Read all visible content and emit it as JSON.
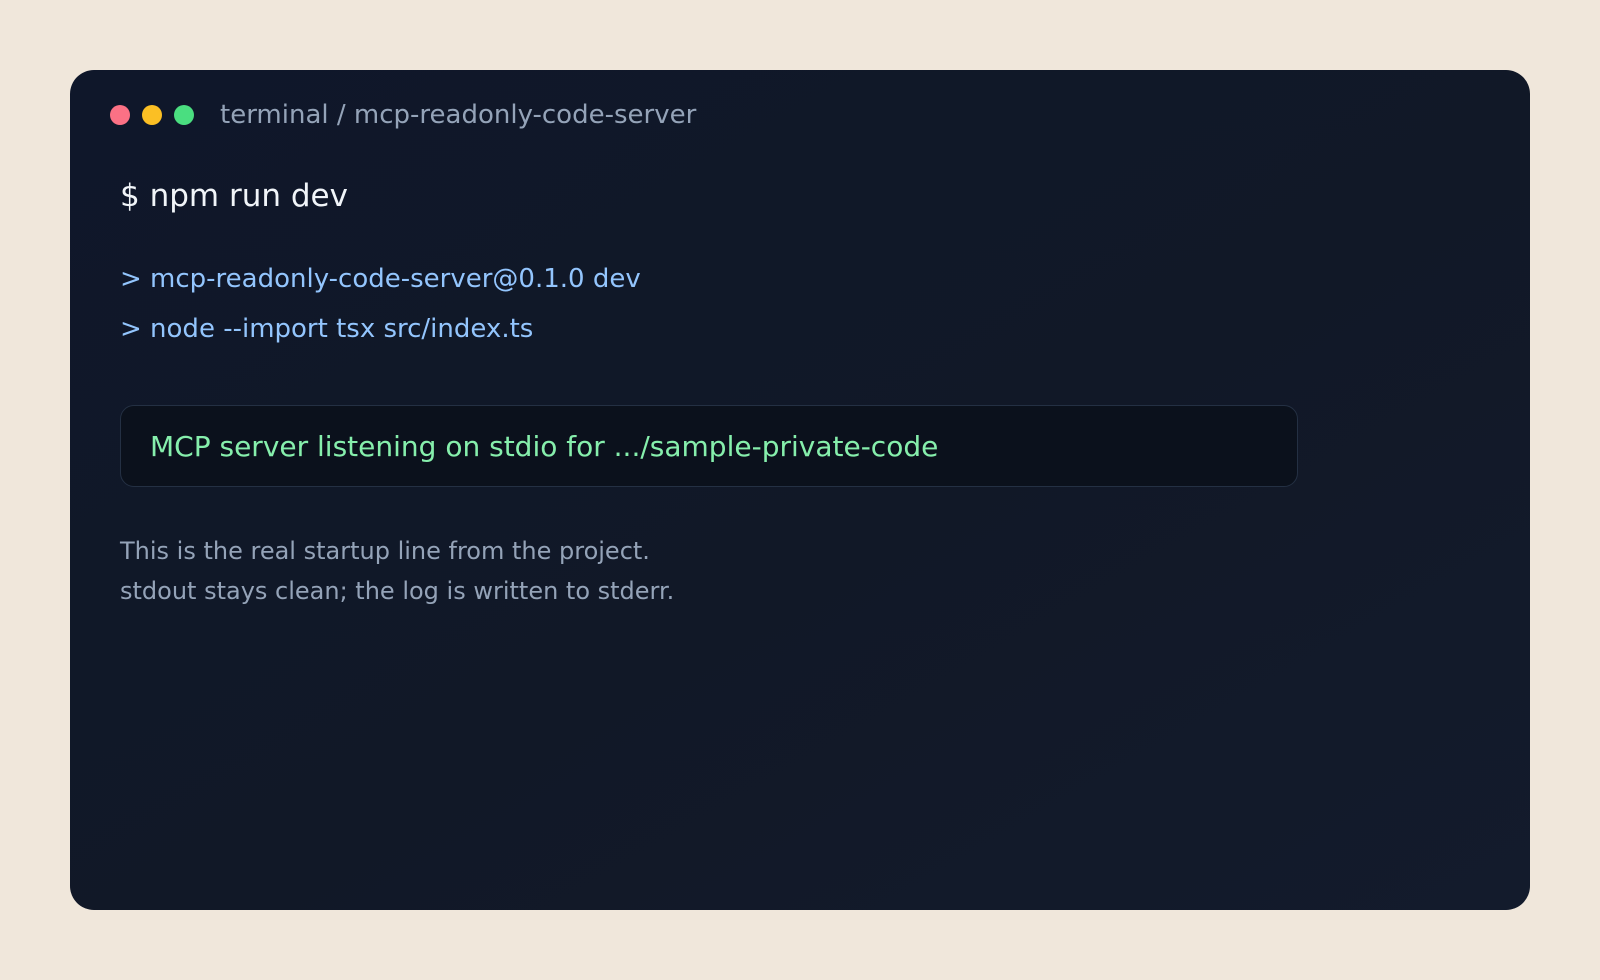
{
  "colors": {
    "background": "#f0e7db",
    "window": "#0f172a",
    "close": "#fb7185",
    "minimize": "#fbbf24",
    "maximize": "#4ade80",
    "command": "#f1f5f9",
    "output": "#93c5fd",
    "success": "#86efac",
    "muted": "#94a3b8"
  },
  "window": {
    "title": "terminal / mcp-readonly-code-server",
    "controls": {
      "close_icon": "circle-red",
      "minimize_icon": "circle-yellow",
      "maximize_icon": "circle-green"
    }
  },
  "terminal": {
    "command": "$ npm run dev",
    "output_lines": [
      "> mcp-readonly-code-server@0.1.0 dev",
      "> node --import tsx src/index.ts"
    ],
    "status": "MCP server listening on stdio for .../sample-private-code",
    "notes": [
      "This is the real startup line from the project.",
      "stdout stays clean; the log is written to stderr."
    ]
  }
}
